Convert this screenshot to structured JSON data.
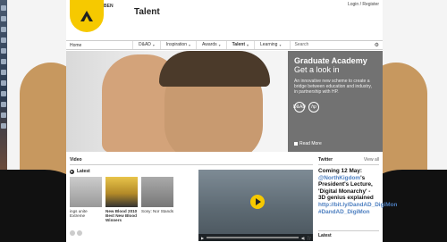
{
  "site": {
    "logo_tag": "BEN",
    "title": "Talent",
    "login_label": "Login / Register"
  },
  "nav": {
    "home": "Home",
    "items": [
      {
        "label": "D&AD",
        "active": false
      },
      {
        "label": "Inspiration",
        "active": false
      },
      {
        "label": "Awards",
        "active": false
      },
      {
        "label": "Talent",
        "active": true
      },
      {
        "label": "Learning",
        "active": false
      }
    ],
    "search_placeholder": "Search"
  },
  "hero": {
    "title": "Graduate Academy",
    "subtitle": "Get a look in",
    "description": "An innovative new scheme to create a bridge between education and industry, in partnership with HP.",
    "logo_dad": "D&AD",
    "logo_hp": "hp",
    "more_label": "Read More"
  },
  "video": {
    "heading": "Video",
    "latest_label": "Latest",
    "thumbs": [
      {
        "caption": "ings unite Extreme"
      },
      {
        "caption": "New Blood 2010 Best New Blood Winners"
      },
      {
        "caption": "Sony: Nor Stands"
      }
    ]
  },
  "twitter": {
    "heading": "Twitter",
    "view_all": "View all",
    "tweet_lead": "Coming 12 May: ",
    "tweet_handle": "@NorthKigdom",
    "tweet_body": "'s President's Lecture, 'Digital Monarchy' - 3D genius explained ",
    "tweet_link": "http://bit.ly/DandAD_DigiMon #DandAD_DigiMon",
    "latest_label": "Latest"
  },
  "colors": {
    "brand_yellow": "#f6c900",
    "hero_panel": "#5a5a5a",
    "link_blue": "#4d7fc0"
  }
}
